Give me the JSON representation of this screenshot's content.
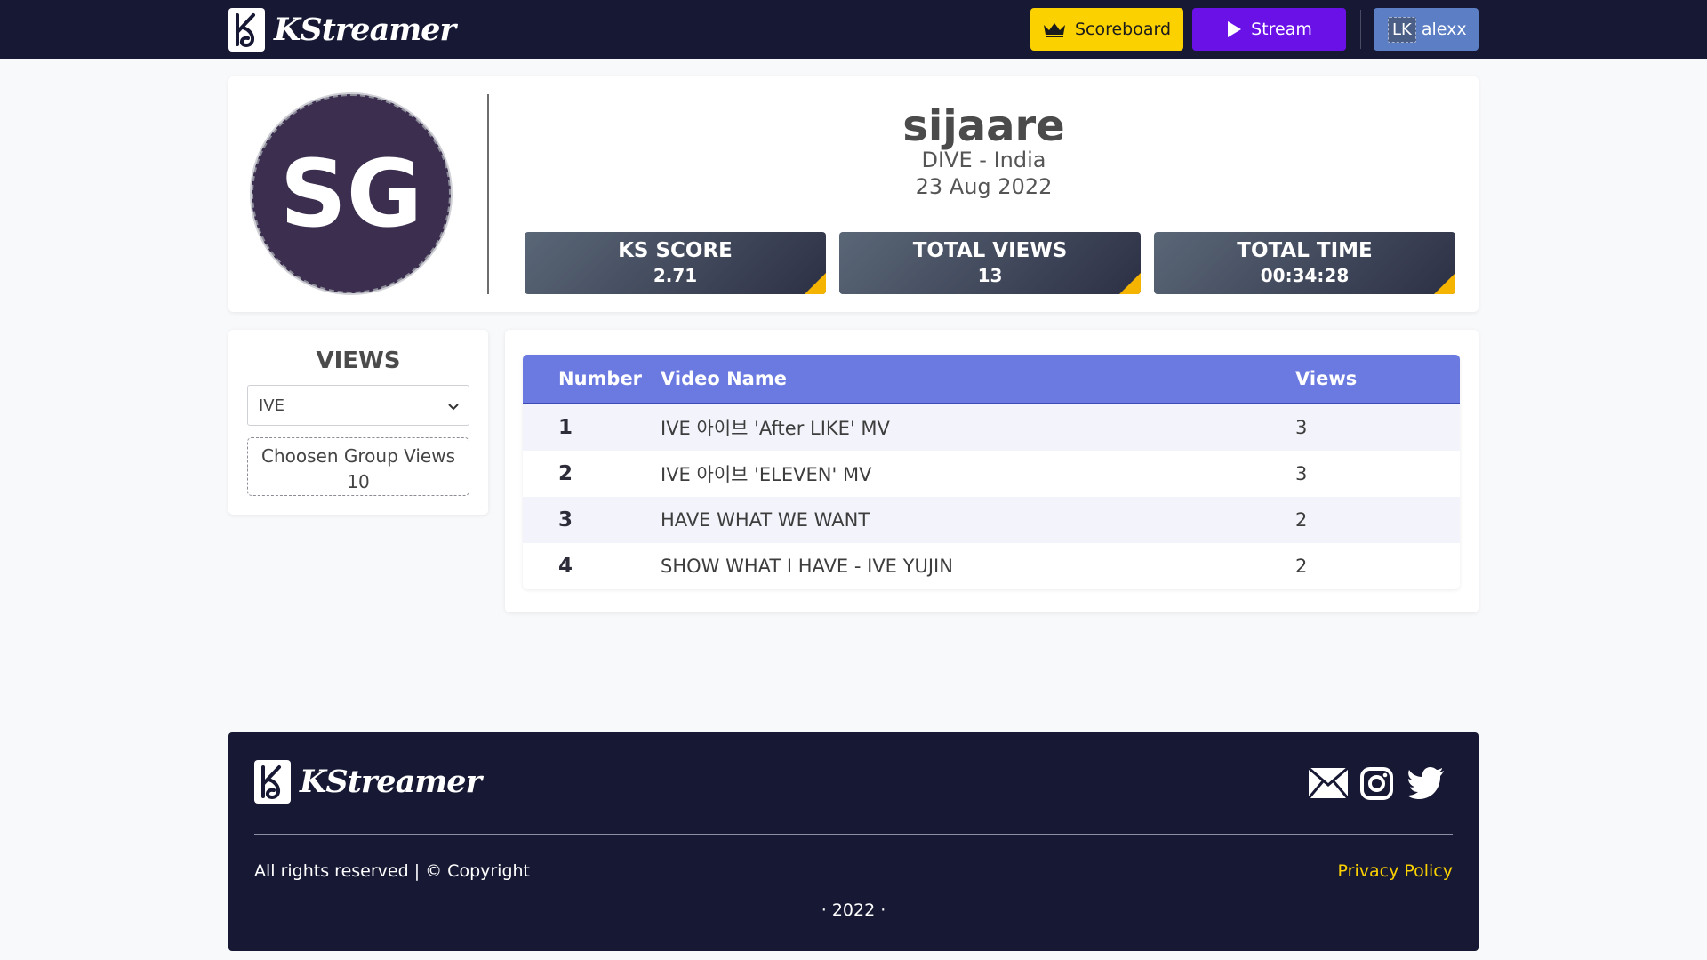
{
  "nav": {
    "brand": "KStreamer",
    "scoreboard_label": "Scoreboard",
    "stream_label": "Stream",
    "user_initials": "LK",
    "user_name": "alexx",
    "colors": {
      "scoreboard": "#fbd100",
      "stream": "#6a11e8",
      "user": "#5b7ec4",
      "bar": "#171834"
    }
  },
  "profile": {
    "initials": "SG",
    "name": "sijaare",
    "group_country": "DIVE - India",
    "date": "23 Aug 2022",
    "stats": [
      {
        "label": "KS SCORE",
        "value": "2.71"
      },
      {
        "label": "TOTAL VIEWS",
        "value": "13"
      },
      {
        "label": "TOTAL TIME",
        "value": "00:34:28"
      }
    ]
  },
  "views": {
    "title": "VIEWS",
    "selected_group": "IVE",
    "chosen_label": "Choosen Group Views",
    "chosen_value": "10"
  },
  "table": {
    "headers": [
      "Number",
      "Video Name",
      "Views"
    ],
    "rows": [
      {
        "number": "1",
        "name": "IVE 아이브 'After LIKE' MV",
        "views": "3"
      },
      {
        "number": "2",
        "name": "IVE 아이브 'ELEVEN' MV",
        "views": "3"
      },
      {
        "number": "3",
        "name": "HAVE WHAT WE WANT",
        "views": "2"
      },
      {
        "number": "4",
        "name": "SHOW WHAT I HAVE - IVE YUJIN",
        "views": "2"
      }
    ]
  },
  "footer": {
    "brand": "KStreamer",
    "rights": "All rights reserved | © Copyright",
    "privacy": "Privacy Policy",
    "year": "· 2022 ·",
    "social_icons": [
      "mail-icon",
      "instagram-icon",
      "twitter-icon"
    ]
  }
}
